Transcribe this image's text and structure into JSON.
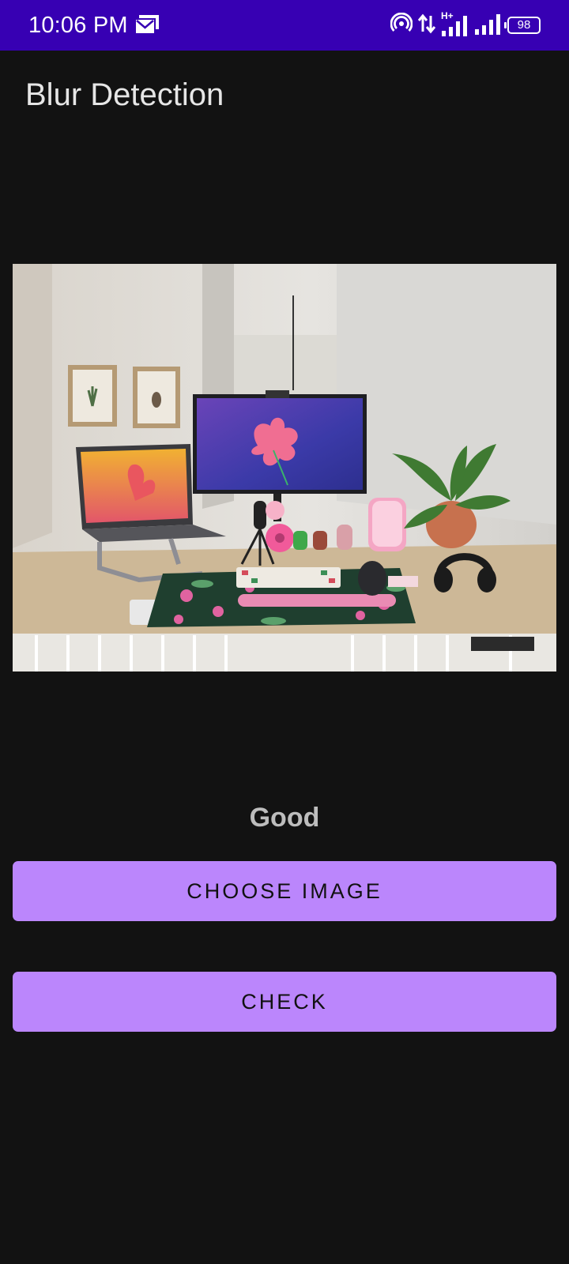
{
  "status_bar": {
    "time": "10:06 PM",
    "battery": "98",
    "network_label": "H+"
  },
  "app": {
    "title": "Blur Detection"
  },
  "preview": {
    "subject": "desk setup with laptop, monitor, plant and lamp"
  },
  "result": {
    "label": "Good"
  },
  "buttons": {
    "choose_label": "CHOOSE IMAGE",
    "check_label": "CHECK"
  },
  "colors": {
    "status_bar": "#3700b3",
    "background": "#121212",
    "button": "#bb86fc",
    "result_text": "#bdbdbd"
  }
}
